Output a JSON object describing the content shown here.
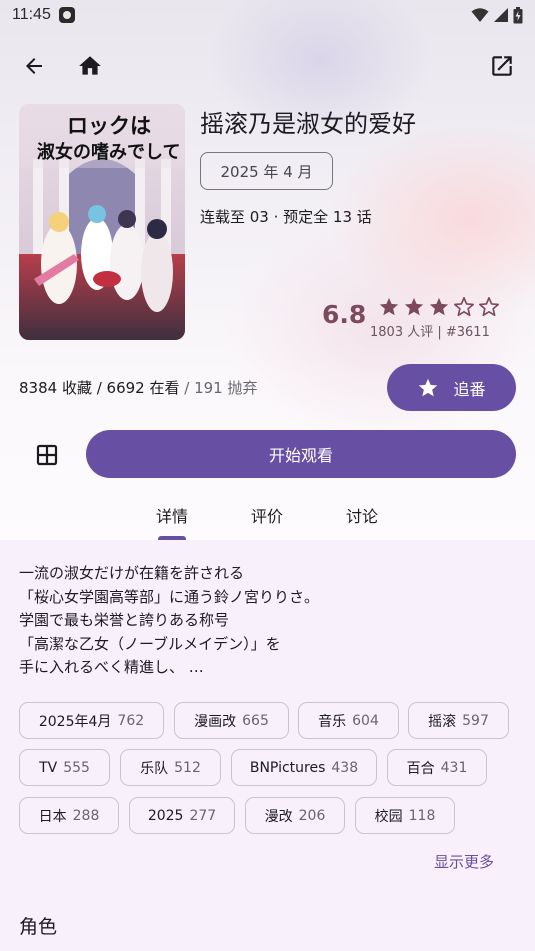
{
  "status_bar": {
    "time": "11:45"
  },
  "colors": {
    "accent": "#6750a4",
    "score": "#7d4a5b",
    "star": "#7d4a5b"
  },
  "icons": {
    "back": "arrow-back-icon",
    "home": "home-icon",
    "open_external": "open-in-new-icon",
    "follow": "star-icon",
    "grid": "grid-icon"
  },
  "subject": {
    "title": "摇滚乃是淑女的爱好",
    "date": "2025 年 4 月",
    "episodes": "连载至 03 · 预定全 13 话",
    "cover_title_line1": "ロックは",
    "cover_title_line2": "淑女の嗜みでして"
  },
  "rating": {
    "score": "6.8",
    "stars_filled": 3,
    "stars_total": 5,
    "meta": "1803 人评 | #3611"
  },
  "collection": {
    "collect": "8384 收藏",
    "sep1": " / ",
    "doing": "6692 在看",
    "sep2": " / ",
    "dropped": "191 抛弃"
  },
  "actions": {
    "follow_label": "追番",
    "watch_label": "开始观看"
  },
  "tabs": [
    {
      "label": "详情",
      "active": true
    },
    {
      "label": "评价",
      "active": false
    },
    {
      "label": "讨论",
      "active": false
    }
  ],
  "summary": "一流の淑女だけが在籍を許される\n「桜心女学園高等部」に通う鈴ノ宮りりさ。\n学園で最も栄誉と誇りある称号\n「高潔な乙女（ノーブルメイデン）」を\n手に入れるべく精進し、 …",
  "tags": [
    {
      "name": "2025年4月",
      "count": "762"
    },
    {
      "name": "漫画改",
      "count": "665"
    },
    {
      "name": "音乐",
      "count": "604"
    },
    {
      "name": "摇滚",
      "count": "597"
    },
    {
      "name": "TV",
      "count": "555"
    },
    {
      "name": "乐队",
      "count": "512"
    },
    {
      "name": "BNPictures",
      "count": "438"
    },
    {
      "name": "百合",
      "count": "431"
    },
    {
      "name": "日本",
      "count": "288"
    },
    {
      "name": "2025",
      "count": "277"
    },
    {
      "name": "漫改",
      "count": "206"
    },
    {
      "name": "校园",
      "count": "118"
    }
  ],
  "show_more": "显示更多",
  "characters_title": "角色"
}
